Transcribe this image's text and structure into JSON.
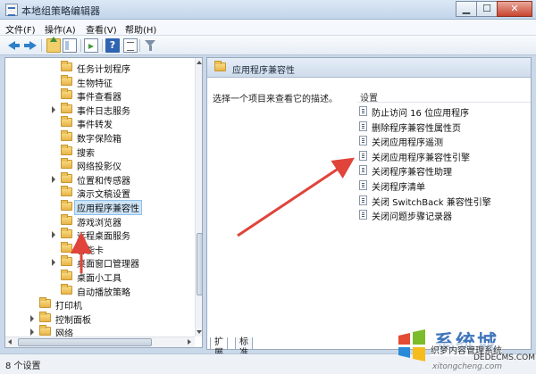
{
  "window": {
    "title": "本地组策略编辑器",
    "minimize": "▁",
    "maximize": "☐",
    "close": "✕"
  },
  "menu": [
    "文件(F)",
    "操作(A)",
    "查看(V)",
    "帮助(H)"
  ],
  "tree": {
    "items": [
      {
        "label": "任务计划程序",
        "expandable": false
      },
      {
        "label": "生物特征",
        "expandable": false
      },
      {
        "label": "事件查看器",
        "expandable": false
      },
      {
        "label": "事件日志服务",
        "expandable": true
      },
      {
        "label": "事件转发",
        "expandable": false
      },
      {
        "label": "数字保险箱",
        "expandable": false
      },
      {
        "label": "搜索",
        "expandable": false
      },
      {
        "label": "网络投影仪",
        "expandable": false
      },
      {
        "label": "位置和传感器",
        "expandable": true
      },
      {
        "label": "演示文稿设置",
        "expandable": false
      },
      {
        "label": "应用程序兼容性",
        "expandable": false,
        "selected": true
      },
      {
        "label": "游戏浏览器",
        "expandable": false
      },
      {
        "label": "远程桌面服务",
        "expandable": true
      },
      {
        "label": "智能卡",
        "expandable": false
      },
      {
        "label": "桌面窗口管理器",
        "expandable": true
      },
      {
        "label": "桌面小工具",
        "expandable": false
      },
      {
        "label": "自动播放策略",
        "expandable": false
      }
    ],
    "root_items": [
      {
        "label": "打印机",
        "expandable": false
      },
      {
        "label": "控制面板",
        "expandable": true
      },
      {
        "label": "网络",
        "expandable": true
      }
    ]
  },
  "content": {
    "title": "应用程序兼容性",
    "description": "选择一个项目来查看它的描述。",
    "column_header": "设置",
    "settings": [
      "防止访问 16 位应用程序",
      "删除程序兼容性属性页",
      "关闭应用程序遥测",
      "关闭应用程序兼容性引擎",
      "关闭程序兼容性助理",
      "关闭程序清单",
      "关闭 SwitchBack 兼容性引擎",
      "关闭问题步骤记录器"
    ]
  },
  "tabs": [
    "扩展",
    "标准"
  ],
  "status": "8 个设置",
  "watermark": {
    "title": "系统城",
    "line1": "织梦内容管理系统",
    "line2": "DEDECMS.COM",
    "line3": "xitongcheng.com"
  },
  "colors": {
    "annotation_arrow": "#e0443a",
    "accent": "#2d7fc9"
  }
}
